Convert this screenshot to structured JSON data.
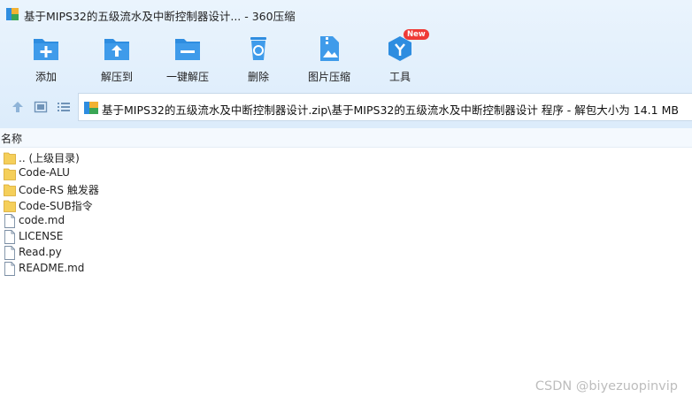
{
  "window": {
    "title": "基于MIPS32的五级流水及中断控制器设计... - 360压缩"
  },
  "toolbar": {
    "items": [
      {
        "label": "添加",
        "icon": "add-icon"
      },
      {
        "label": "解压到",
        "icon": "extract-to-icon"
      },
      {
        "label": "一键解压",
        "icon": "one-click-extract-icon"
      },
      {
        "label": "删除",
        "icon": "delete-icon"
      },
      {
        "label": "图片压缩",
        "icon": "image-compress-icon"
      },
      {
        "label": "工具",
        "icon": "tools-icon",
        "badge": "New"
      }
    ]
  },
  "address": {
    "path": "基于MIPS32的五级流水及中断控制器设计.zip\\基于MIPS32的五级流水及中断控制器设计 程序 - 解包大小为 14.1 MB"
  },
  "columns": {
    "name_header": "名称"
  },
  "files": [
    {
      "name": ".. (上级目录)",
      "type": "folder"
    },
    {
      "name": "Code-ALU",
      "type": "folder"
    },
    {
      "name": "Code-RS 触发器",
      "type": "folder"
    },
    {
      "name": "Code-SUB指令",
      "type": "folder"
    },
    {
      "name": "code.md",
      "type": "file"
    },
    {
      "name": "LICENSE",
      "type": "file"
    },
    {
      "name": "Read.py",
      "type": "file"
    },
    {
      "name": "README.md",
      "type": "file"
    }
  ],
  "watermark": "CSDN @biyezuopinvip",
  "colors": {
    "accent": "#2e8de0",
    "toolbar_bg": "#e3f0fc",
    "folder": "#f5cf5a",
    "badge": "#ef3a36"
  }
}
